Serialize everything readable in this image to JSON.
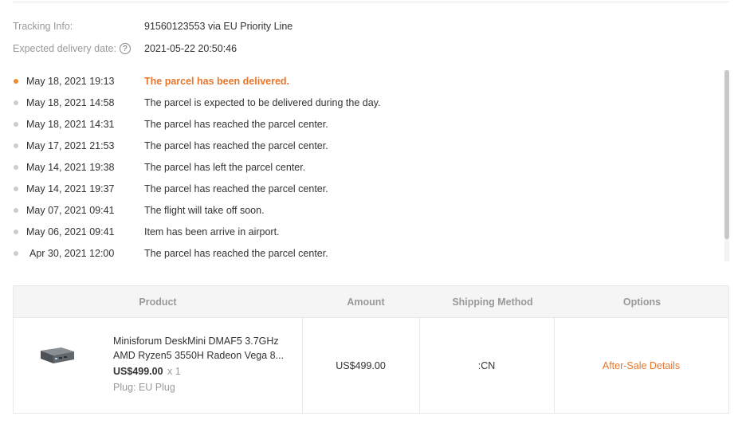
{
  "tracking": {
    "info_label": "Tracking Info:",
    "info_value": "91560123553 via EU Priority Line",
    "expected_label": "Expected delivery date:",
    "expected_value": "2021-05-22 20:50:46"
  },
  "timeline": {
    "events": [
      {
        "date": "May 18, 2021 19:13",
        "text": "The parcel has been delivered.",
        "active": true
      },
      {
        "date": "May 18, 2021 14:58",
        "text": "The parcel is expected to be delivered during the day.",
        "active": false
      },
      {
        "date": "May 18, 2021 14:31",
        "text": "The parcel has reached the parcel center.",
        "active": false
      },
      {
        "date": "May 17, 2021 21:53",
        "text": "The parcel has reached the parcel center.",
        "active": false
      },
      {
        "date": "May 14, 2021 19:38",
        "text": "The parcel has left the parcel center.",
        "active": false
      },
      {
        "date": "May 14, 2021 19:37",
        "text": "The parcel has reached the parcel center.",
        "active": false
      },
      {
        "date": "May 07, 2021 09:41",
        "text": "The flight will take off soon.",
        "active": false
      },
      {
        "date": "May 06, 2021 09:41",
        "text": "Item has been arrive in airport.",
        "active": false
      },
      {
        "date": "Apr 30, 2021 12:00",
        "text": "The parcel has reached the parcel center.",
        "active": false
      }
    ]
  },
  "table": {
    "headers": {
      "product": "Product",
      "amount": "Amount",
      "shipping": "Shipping Method",
      "options": "Options"
    },
    "row": {
      "name_line1": "Minisforum DeskMini DMAF5 3.7GHz",
      "name_line2": "AMD Ryzen5 3550H Radeon Vega 8...",
      "price": "US$499.00",
      "qty": "x 1",
      "plug": "Plug: EU Plug",
      "amount": "US$499.00",
      "shipping": ":CN",
      "option": "After-Sale Details"
    }
  },
  "colors": {
    "accent": "#e8752a",
    "active_dot": "#f08a2e",
    "muted_text": "#999999",
    "border": "#e8e8e8",
    "header_bg": "#f5f5f5"
  },
  "icons": {
    "help": "question-circle-icon",
    "product_image": "mini-pc-thumbnail"
  }
}
